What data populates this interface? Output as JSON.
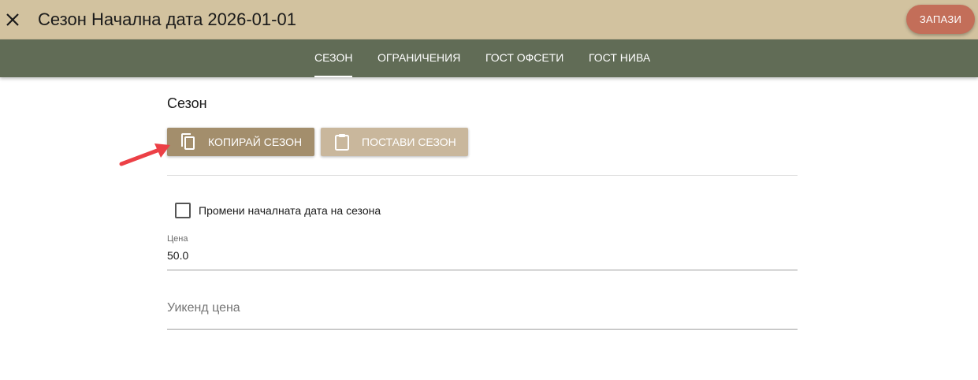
{
  "header": {
    "title": "Сезон Начална дата 2026-01-01",
    "close_icon": "close-icon",
    "save_label": "ЗАПАЗИ"
  },
  "tabs": [
    {
      "label": "СЕЗОН",
      "active": true
    },
    {
      "label": "ОГРАНИЧЕНИЯ",
      "active": false
    },
    {
      "label": "ГОСТ ОФСЕТИ",
      "active": false
    },
    {
      "label": "ГОСТ НИВА",
      "active": false
    }
  ],
  "section": {
    "title": "Сезон",
    "copy_button": {
      "label": "КОПИРАЙ СЕЗОН",
      "icon": "copy-icon"
    },
    "paste_button": {
      "label": "ПОСТАВИ СЕЗОН",
      "icon": "clipboard-icon"
    },
    "checkbox": {
      "label": "Промени началната дата на сезона",
      "checked": false
    },
    "price": {
      "label": "Цена",
      "value": "50.0"
    },
    "weekend_price": {
      "placeholder": "Уикенд цена",
      "value": ""
    }
  },
  "colors": {
    "topbar": "#d2c29f",
    "tabbar": "#616c56",
    "save_button": "#c36e59",
    "copy_button": "#a38e6c",
    "paste_button": "#c9b79c",
    "annotation_arrow": "#ec4046"
  }
}
